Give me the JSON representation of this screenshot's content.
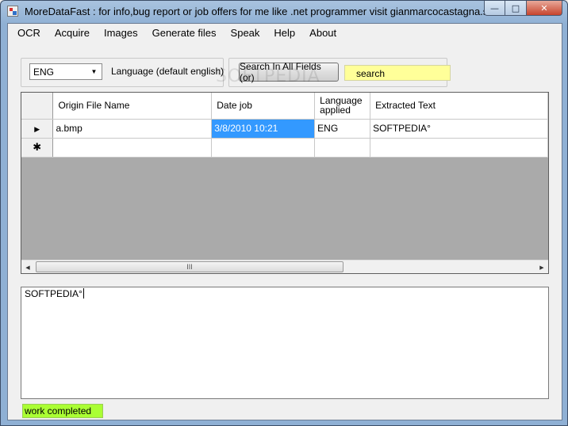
{
  "window": {
    "title": "MoreDataFast : for info,bug report or  job offers for me like .net programmer visit gianmarcocastagna.som..."
  },
  "caption_buttons": {
    "minimize": "—",
    "maximize": "□",
    "close": "✕"
  },
  "menu": {
    "items": [
      {
        "label": "OCR"
      },
      {
        "label": "Acquire"
      },
      {
        "label": "Images"
      },
      {
        "label": "Generate files"
      },
      {
        "label": "Speak"
      },
      {
        "label": "Help"
      },
      {
        "label": "About"
      }
    ]
  },
  "language": {
    "selected": "ENG",
    "label": "Language (default english)"
  },
  "search": {
    "button_label": "Search In All Fields (or)",
    "input_value": "search"
  },
  "grid": {
    "columns": [
      "Origin File Name",
      "Date job",
      "Language applied",
      "Extracted Text"
    ],
    "rows": [
      {
        "indicator": "▶",
        "cells": [
          "a.bmp",
          "3/8/2010  10:21",
          "ENG",
          "SOFTPEDIA°"
        ]
      }
    ],
    "new_row_indicator": "✱",
    "scroll_thumb": "III"
  },
  "output": {
    "text": "SOFTPEDIA°"
  },
  "status": {
    "text": "work completed"
  },
  "colors": {
    "status_bg": "#aaff33",
    "search_bg": "#ffff99",
    "selection": "#3399ff"
  },
  "watermark": "SOFTPEDIA"
}
